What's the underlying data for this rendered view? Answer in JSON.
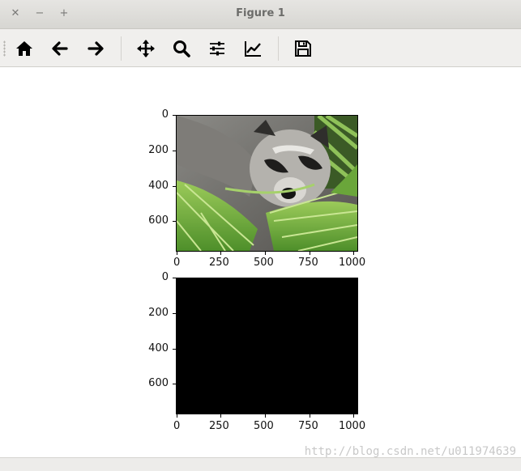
{
  "window": {
    "title": "Figure 1",
    "close_glyph": "✕",
    "minimize_glyph": "−",
    "maximize_glyph": "+"
  },
  "toolbar": {
    "items": [
      {
        "name": "home-icon",
        "tooltip": "Reset original view"
      },
      {
        "name": "back-arrow-icon",
        "tooltip": "Back to previous view"
      },
      {
        "name": "forward-arrow-icon",
        "tooltip": "Forward to next view"
      },
      {
        "name": "pan-move-icon",
        "tooltip": "Pan axes"
      },
      {
        "name": "zoom-magnifier-icon",
        "tooltip": "Zoom to rectangle"
      },
      {
        "name": "subplots-sliders-icon",
        "tooltip": "Configure subplots"
      },
      {
        "name": "edit-curve-icon",
        "tooltip": "Edit axis, curve and image parameters"
      },
      {
        "name": "save-floppy-icon",
        "tooltip": "Save the figure"
      }
    ]
  },
  "plots": {
    "top": {
      "image": "raccoon photograph (face sample image)",
      "xticks": [
        "0",
        "250",
        "500",
        "750",
        "1000"
      ],
      "yticks": [
        "0",
        "200",
        "400",
        "600"
      ]
    },
    "bottom": {
      "image": "solid black image",
      "xticks": [
        "0",
        "250",
        "500",
        "750",
        "1000"
      ],
      "yticks": [
        "0",
        "200",
        "400",
        "600"
      ]
    }
  },
  "watermark": "http://blog.csdn.net/u011974639",
  "colors": {
    "titlebar": "#dcdbd7",
    "toolbar": "#f0efed",
    "icon": "#000000",
    "black_image": "#000000"
  }
}
